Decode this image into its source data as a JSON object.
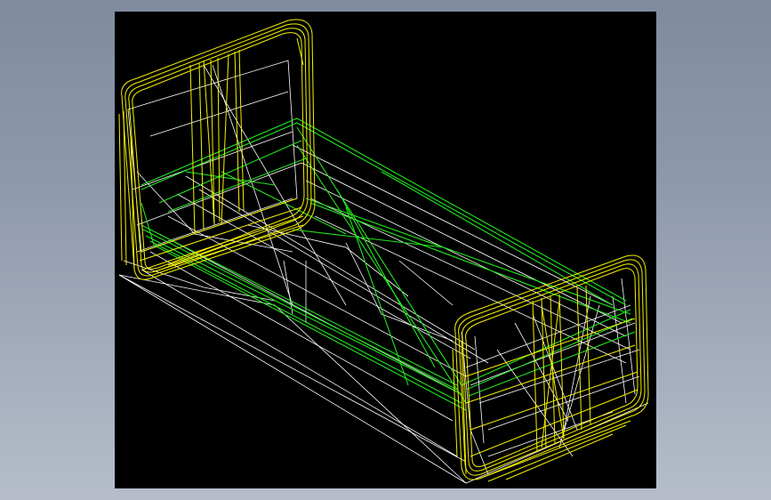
{
  "viewport": {
    "background": "#000000",
    "colors": {
      "headboard_wire": "#f5f000",
      "frame_wire": "#ffffff",
      "rail_wire": "#22e61e"
    }
  },
  "model": {
    "parts": [
      "headboard",
      "footboard",
      "side-rails",
      "bed-frame"
    ],
    "render_mode": "wireframe"
  }
}
